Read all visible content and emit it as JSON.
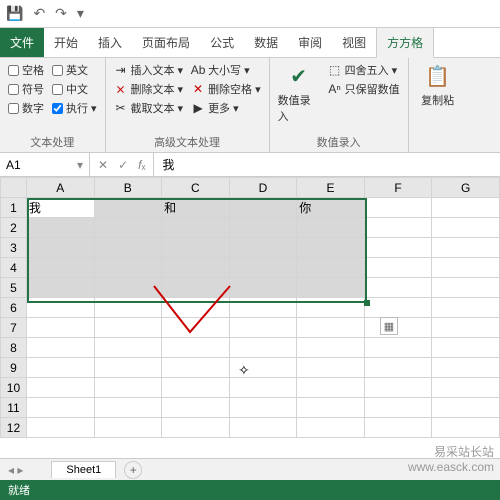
{
  "qat": {
    "save": "💾",
    "undo": "↶",
    "redo": "↷",
    "custom": "▾"
  },
  "tabs": {
    "file": "文件",
    "home": "开始",
    "insert": "插入",
    "layout": "页面布局",
    "formula": "公式",
    "data": "数据",
    "review": "审阅",
    "view": "视图",
    "tool": "方方格"
  },
  "ribbon": {
    "g1": {
      "label": "文本处理",
      "space": "空格",
      "eng": "英文",
      "symbol": "符号",
      "cn": "中文",
      "num": "数字",
      "exec": "执行"
    },
    "g2": {
      "label": "高级文本处理",
      "insert": "插入文本",
      "delete": "删除文本",
      "cut": "截取文本",
      "case": "大小写",
      "delspace": "删除空格",
      "more": "更多"
    },
    "g3": {
      "label": "数值录入",
      "big": "数值录入",
      "round": "四舍五入",
      "keep": "只保留数值"
    },
    "g4": {
      "big": "复制粘"
    }
  },
  "namebox": "A1",
  "formula": "我",
  "cols": [
    "A",
    "B",
    "C",
    "D",
    "E",
    "F",
    "G"
  ],
  "rows": [
    "1",
    "2",
    "3",
    "4",
    "5",
    "6",
    "7",
    "8",
    "9",
    "10",
    "11",
    "12"
  ],
  "cells": {
    "A1": "我",
    "C1": "和",
    "E1": "你"
  },
  "sheettab": "Sheet1",
  "status": "就绪",
  "wm1": "易采站长站",
  "wm2": "www.easck.com"
}
